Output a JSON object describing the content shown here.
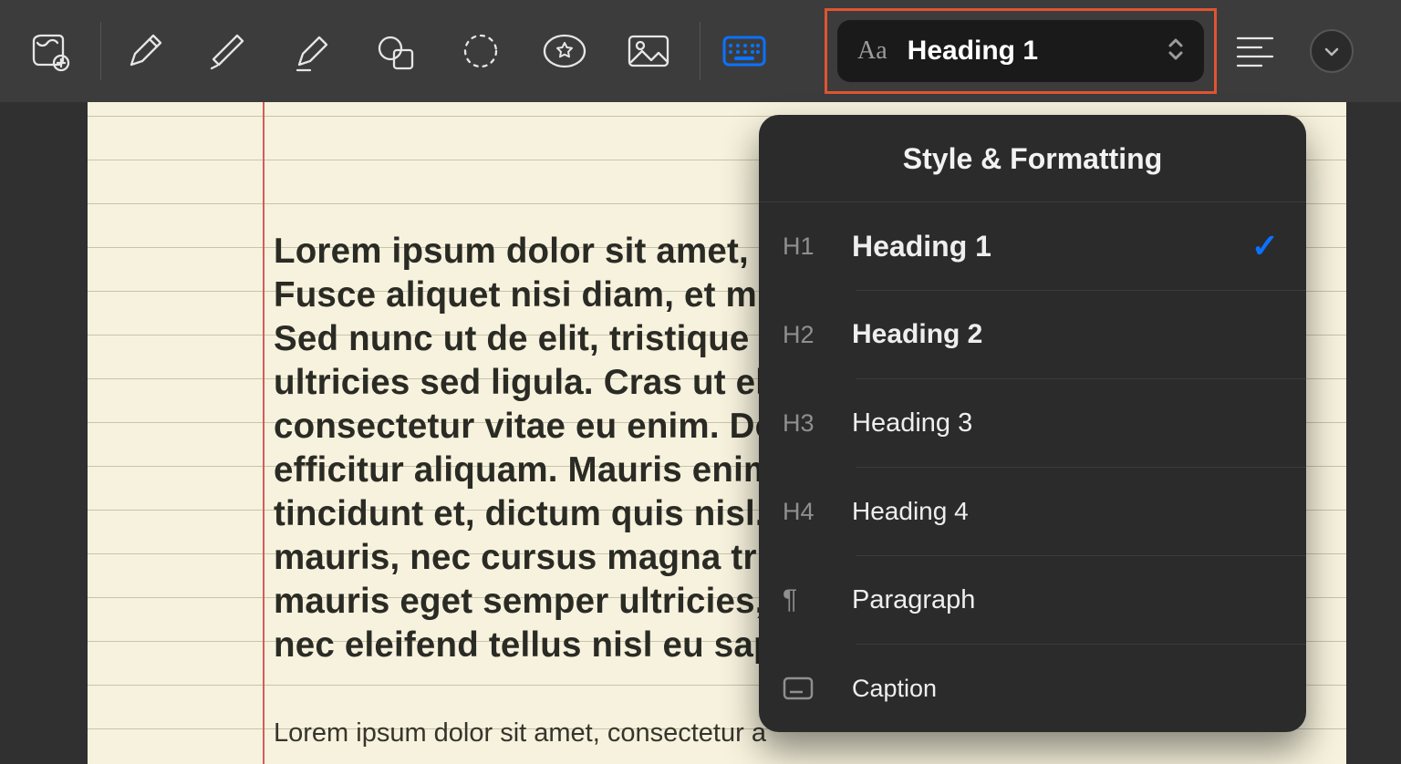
{
  "toolbar": {
    "tools": [
      "markup",
      "pen",
      "marker",
      "highlighter",
      "shapes",
      "lasso",
      "sticker",
      "image"
    ],
    "style_selector": {
      "label": "Heading 1",
      "icon": "Aa"
    }
  },
  "document": {
    "heading_lines": [
      "Lorem ipsum dolor sit amet, c",
      "Fusce aliquet nisi diam, et m",
      "Sed nunc ut de elit, tristique s",
      "ultricies sed ligula. Cras ut eli",
      "consectetur vitae eu enim. Do",
      "efficitur aliquam. Mauris enim",
      "tincidunt et, dictum quis nisl.",
      "mauris, nec cursus magna tris",
      "mauris eget semper ultricies,",
      "nec eleifend tellus nisl eu sap"
    ],
    "caption_line": "Lorem ipsum dolor sit amet, consectetur a"
  },
  "popover": {
    "title": "Style & Formatting",
    "items": [
      {
        "tag": "H1",
        "label": "Heading 1",
        "selected": true
      },
      {
        "tag": "H2",
        "label": "Heading 2",
        "selected": false
      },
      {
        "tag": "H3",
        "label": "Heading 3",
        "selected": false
      },
      {
        "tag": "H4",
        "label": "Heading 4",
        "selected": false
      },
      {
        "tag": "¶",
        "label": "Paragraph",
        "selected": false
      },
      {
        "tag": "cap",
        "label": "Caption",
        "selected": false
      }
    ]
  }
}
